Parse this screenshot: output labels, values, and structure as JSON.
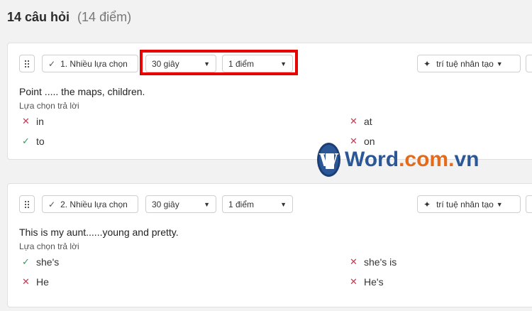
{
  "header": {
    "title": "14 câu hỏi",
    "points": "(14 điểm)"
  },
  "questions": [
    {
      "type_label": "1. Nhiều lựa chọn",
      "time": "30 giây",
      "points": "1 điểm",
      "ai_label": "trí tuệ nhân tạo",
      "text": "Point ..... the maps, children.",
      "answers_label": "Lựa chọn trả lời",
      "options": [
        {
          "text": "in",
          "correct": false
        },
        {
          "text": "at",
          "correct": false
        },
        {
          "text": "to",
          "correct": true
        },
        {
          "text": "on",
          "correct": false
        }
      ]
    },
    {
      "type_label": "2. Nhiều lựa chọn",
      "time": "30 giây",
      "points": "1 điểm",
      "ai_label": "trí tuệ nhân tạo",
      "text": "This is my aunt......young and pretty.",
      "answers_label": "Lựa chọn trả lời",
      "options": [
        {
          "text": "she's",
          "correct": true
        },
        {
          "text": "she's is",
          "correct": false
        },
        {
          "text": "He",
          "correct": false
        },
        {
          "text": "He's",
          "correct": false
        }
      ]
    }
  ],
  "watermark": {
    "brand": "Word",
    "sep": ".",
    "domain": "com",
    "tld": "vn"
  },
  "colors": {
    "highlight": "#e60000",
    "correct": "#2e9d5e",
    "wrong": "#d6334e",
    "brand": "#2b5797"
  },
  "icons": {
    "drag": "drag-handle-icon",
    "check": "check-icon",
    "caret": "caret-down-icon",
    "spark": "sparkle-icon",
    "wrong": "cross-icon"
  }
}
